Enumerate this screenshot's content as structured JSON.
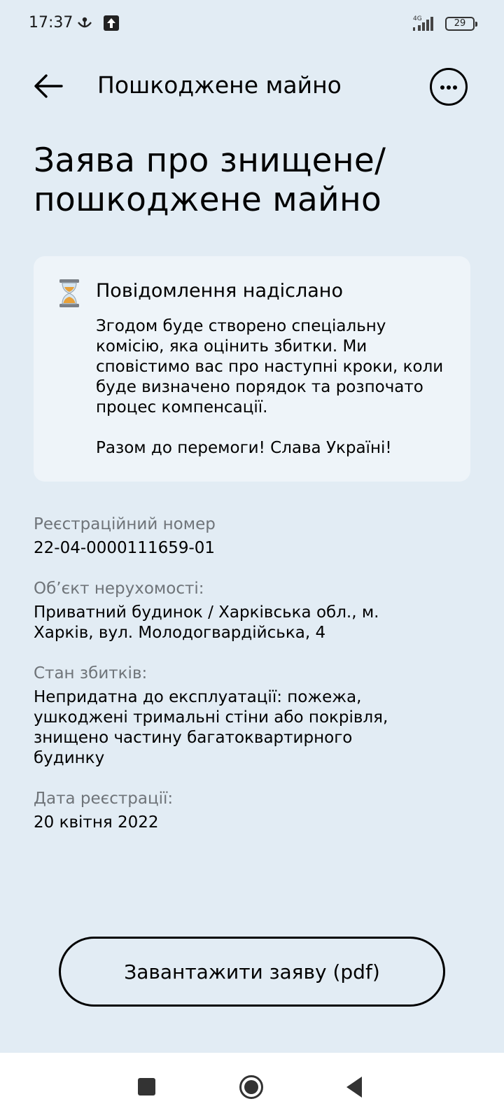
{
  "status_bar": {
    "time": "17:37",
    "network": "4G",
    "battery": "29",
    "icons": [
      "usb-debug-icon",
      "upload-icon",
      "signal-icon",
      "battery-icon"
    ]
  },
  "header": {
    "title": "Пошкоджене майно",
    "icons": [
      "arrow-left-icon",
      "more-dots-icon"
    ]
  },
  "page": {
    "title": "Заява про знищене/ пошкоджене майно"
  },
  "notice": {
    "icon": "hourglass-icon",
    "title": "Повідомлення надіслано",
    "body": "Згодом буде створено спеціальну комісію, яка оцінить збитки. Ми сповістимо вас про наступні кроки, коли буде визначено порядок та розпочато процес компенсації.",
    "closing": "Разом до перемоги! Слава Україні!"
  },
  "details": [
    {
      "label": "Реєстраційний номер",
      "value": "22-04-0000111659-01"
    },
    {
      "label": "Об’єкт нерухомості:",
      "value": "Приватний будинок / Харківська обл., м. Харків, вул. Молодогвардійська, 4"
    },
    {
      "label": "Стан збитків:",
      "value": "Непридатна до експлуатації: пожежа, ушкоджені тримальні стіни або покрівля, знищено частину багатоквартирного будинку"
    },
    {
      "label": "Дата реєстрації:",
      "value": "20 квітня 2022"
    }
  ],
  "actions": {
    "download_label": "Завантажити заяву (pdf)"
  },
  "nav_bar": {
    "icons": [
      "recent-apps-icon",
      "home-icon",
      "back-triangle-icon"
    ]
  },
  "colors": {
    "background": "#E2ECF4",
    "card": "#EEF4F9",
    "label": "#6F7479",
    "text": "#000000"
  }
}
